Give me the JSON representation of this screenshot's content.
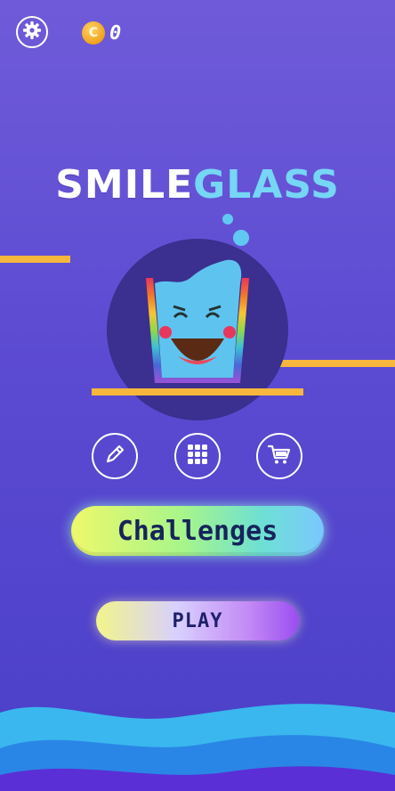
{
  "topbar": {
    "settings_icon": "gear-icon",
    "coin_icon": "coin-icon",
    "coin_glyph": "C",
    "coin_count": "0"
  },
  "logo": {
    "word1": "SMILE",
    "word2": "GLASS"
  },
  "menu": {
    "icons": [
      "pencil-icon",
      "grid-icon",
      "cart-icon"
    ],
    "challenges_label": "Challenges",
    "play_label": "PLAY"
  },
  "colors": {
    "background_top": "#6f5bd9",
    "background_bottom": "#4a3fc8",
    "logo_white": "#ffffff",
    "logo_blue": "#76d6f5",
    "platform": "#f6b73c",
    "glass_water": "#5fc3ef",
    "circle_bg": "#3b2f8f"
  }
}
